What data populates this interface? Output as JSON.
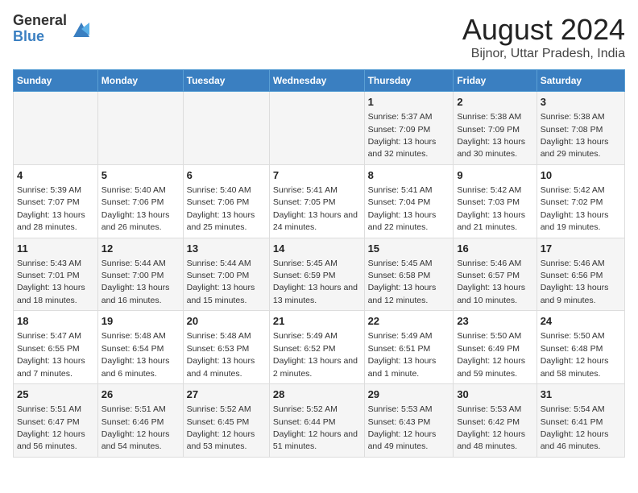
{
  "logo": {
    "general": "General",
    "blue": "Blue"
  },
  "title": "August 2024",
  "subtitle": "Bijnor, Uttar Pradesh, India",
  "days_of_week": [
    "Sunday",
    "Monday",
    "Tuesday",
    "Wednesday",
    "Thursday",
    "Friday",
    "Saturday"
  ],
  "weeks": [
    [
      {
        "day": "",
        "info": ""
      },
      {
        "day": "",
        "info": ""
      },
      {
        "day": "",
        "info": ""
      },
      {
        "day": "",
        "info": ""
      },
      {
        "day": "1",
        "info": "Sunrise: 5:37 AM\nSunset: 7:09 PM\nDaylight: 13 hours and 32 minutes."
      },
      {
        "day": "2",
        "info": "Sunrise: 5:38 AM\nSunset: 7:09 PM\nDaylight: 13 hours and 30 minutes."
      },
      {
        "day": "3",
        "info": "Sunrise: 5:38 AM\nSunset: 7:08 PM\nDaylight: 13 hours and 29 minutes."
      }
    ],
    [
      {
        "day": "4",
        "info": "Sunrise: 5:39 AM\nSunset: 7:07 PM\nDaylight: 13 hours and 28 minutes."
      },
      {
        "day": "5",
        "info": "Sunrise: 5:40 AM\nSunset: 7:06 PM\nDaylight: 13 hours and 26 minutes."
      },
      {
        "day": "6",
        "info": "Sunrise: 5:40 AM\nSunset: 7:06 PM\nDaylight: 13 hours and 25 minutes."
      },
      {
        "day": "7",
        "info": "Sunrise: 5:41 AM\nSunset: 7:05 PM\nDaylight: 13 hours and 24 minutes."
      },
      {
        "day": "8",
        "info": "Sunrise: 5:41 AM\nSunset: 7:04 PM\nDaylight: 13 hours and 22 minutes."
      },
      {
        "day": "9",
        "info": "Sunrise: 5:42 AM\nSunset: 7:03 PM\nDaylight: 13 hours and 21 minutes."
      },
      {
        "day": "10",
        "info": "Sunrise: 5:42 AM\nSunset: 7:02 PM\nDaylight: 13 hours and 19 minutes."
      }
    ],
    [
      {
        "day": "11",
        "info": "Sunrise: 5:43 AM\nSunset: 7:01 PM\nDaylight: 13 hours and 18 minutes."
      },
      {
        "day": "12",
        "info": "Sunrise: 5:44 AM\nSunset: 7:00 PM\nDaylight: 13 hours and 16 minutes."
      },
      {
        "day": "13",
        "info": "Sunrise: 5:44 AM\nSunset: 7:00 PM\nDaylight: 13 hours and 15 minutes."
      },
      {
        "day": "14",
        "info": "Sunrise: 5:45 AM\nSunset: 6:59 PM\nDaylight: 13 hours and 13 minutes."
      },
      {
        "day": "15",
        "info": "Sunrise: 5:45 AM\nSunset: 6:58 PM\nDaylight: 13 hours and 12 minutes."
      },
      {
        "day": "16",
        "info": "Sunrise: 5:46 AM\nSunset: 6:57 PM\nDaylight: 13 hours and 10 minutes."
      },
      {
        "day": "17",
        "info": "Sunrise: 5:46 AM\nSunset: 6:56 PM\nDaylight: 13 hours and 9 minutes."
      }
    ],
    [
      {
        "day": "18",
        "info": "Sunrise: 5:47 AM\nSunset: 6:55 PM\nDaylight: 13 hours and 7 minutes."
      },
      {
        "day": "19",
        "info": "Sunrise: 5:48 AM\nSunset: 6:54 PM\nDaylight: 13 hours and 6 minutes."
      },
      {
        "day": "20",
        "info": "Sunrise: 5:48 AM\nSunset: 6:53 PM\nDaylight: 13 hours and 4 minutes."
      },
      {
        "day": "21",
        "info": "Sunrise: 5:49 AM\nSunset: 6:52 PM\nDaylight: 13 hours and 2 minutes."
      },
      {
        "day": "22",
        "info": "Sunrise: 5:49 AM\nSunset: 6:51 PM\nDaylight: 13 hours and 1 minute."
      },
      {
        "day": "23",
        "info": "Sunrise: 5:50 AM\nSunset: 6:49 PM\nDaylight: 12 hours and 59 minutes."
      },
      {
        "day": "24",
        "info": "Sunrise: 5:50 AM\nSunset: 6:48 PM\nDaylight: 12 hours and 58 minutes."
      }
    ],
    [
      {
        "day": "25",
        "info": "Sunrise: 5:51 AM\nSunset: 6:47 PM\nDaylight: 12 hours and 56 minutes."
      },
      {
        "day": "26",
        "info": "Sunrise: 5:51 AM\nSunset: 6:46 PM\nDaylight: 12 hours and 54 minutes."
      },
      {
        "day": "27",
        "info": "Sunrise: 5:52 AM\nSunset: 6:45 PM\nDaylight: 12 hours and 53 minutes."
      },
      {
        "day": "28",
        "info": "Sunrise: 5:52 AM\nSunset: 6:44 PM\nDaylight: 12 hours and 51 minutes."
      },
      {
        "day": "29",
        "info": "Sunrise: 5:53 AM\nSunset: 6:43 PM\nDaylight: 12 hours and 49 minutes."
      },
      {
        "day": "30",
        "info": "Sunrise: 5:53 AM\nSunset: 6:42 PM\nDaylight: 12 hours and 48 minutes."
      },
      {
        "day": "31",
        "info": "Sunrise: 5:54 AM\nSunset: 6:41 PM\nDaylight: 12 hours and 46 minutes."
      }
    ]
  ]
}
